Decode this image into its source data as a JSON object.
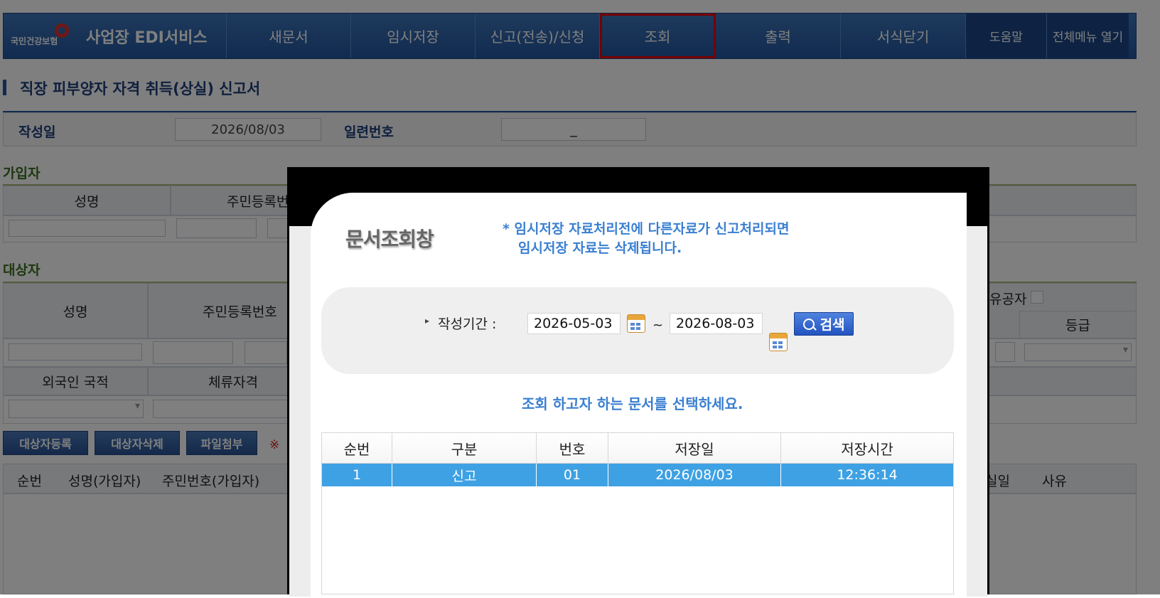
{
  "nav": {
    "logo_small": "국민건강보험",
    "title": "사업장 EDI서비스",
    "items": [
      "새문서",
      "임시저장",
      "신고(전송)/신청",
      "조회",
      "출력",
      "서식닫기"
    ],
    "help": "도움말",
    "all_menu": "전체메뉴 열기"
  },
  "form": {
    "title": "직장 피부양자 자격 취득(상실) 신고서",
    "write_date_label": "작성일",
    "write_date_value": "2026/08/03",
    "serial_label": "일련번호",
    "serial_value": "_",
    "subscriber_label": "가입자",
    "sub_name": "성명",
    "sub_rrn": "주민등록번",
    "target_label": "대상자",
    "tgt_name": "성명",
    "tgt_rrn": "주민등록번호",
    "tgt_merit": "유공자",
    "tgt_grade": "등급",
    "tgt_nationality": "외국인 국적",
    "tgt_visa": "체류자격",
    "btn_register": "대상자등록",
    "btn_delete": "대상자삭제",
    "btn_attach": "파일첨부",
    "note_mark": "※",
    "list_headers": [
      "순번",
      "성명(가입자)",
      "주민번호(가입자)"
    ],
    "list_headers_right": [
      "실일",
      "사유"
    ]
  },
  "modal": {
    "title": "문서조회창",
    "notice_line1": "* 임시저장 자료처리전에 다른자료가 신고처리되면",
    "notice_line2": "임시저장 자료는 삭제됩니다.",
    "period_label": "작성기간 :",
    "date_from": "2026-05-03",
    "tilde": "~",
    "date_to": "2026-08-03",
    "search_label": "검색",
    "hint": "조회 하고자 하는 문서를 선택하세요.",
    "headers": [
      "순번",
      "구분",
      "번호",
      "저장일",
      "저장시간"
    ],
    "rows": [
      [
        "1",
        "신고",
        "01",
        "2026/08/03",
        "12:36:14"
      ]
    ]
  },
  "colors": {
    "nav_blue": "#2357a0",
    "notice_blue": "#3a7fd0",
    "row_selected": "#3ea1e3",
    "highlight_red": "#e00000"
  }
}
